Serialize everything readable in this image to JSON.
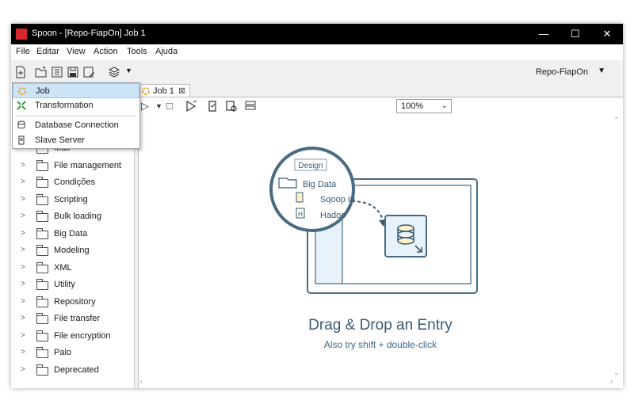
{
  "window": {
    "title": "Spoon - [Repo-FiapOn] Job 1",
    "minimize": "—",
    "maximize": "☐",
    "close": "✕"
  },
  "menubar": [
    "File",
    "Editar",
    "View",
    "Action",
    "Tools",
    "Ajuda"
  ],
  "toolbar": {
    "icons": [
      "new-file-icon",
      "open-folder-icon",
      "explore-icon",
      "save-icon",
      "save-as-icon",
      "layers-icon"
    ],
    "repository": "Repo-FiapOn"
  },
  "new_dropdown": {
    "items": [
      {
        "label": "Job",
        "icon": "job-icon",
        "selected": true
      },
      {
        "label": "Transformation",
        "icon": "transformation-icon",
        "selected": false
      },
      {
        "label": "Database Connection",
        "icon": "database-icon",
        "selected": false
      },
      {
        "label": "Slave Server",
        "icon": "server-icon",
        "selected": false
      }
    ]
  },
  "tree": {
    "items": [
      "Mail",
      "File management",
      "Condições",
      "Scripting",
      "Bulk loading",
      "Big Data",
      "Modeling",
      "XML",
      "Utility",
      "Repository",
      "File transfer",
      "File encryption",
      "Palo",
      "Deprecated"
    ]
  },
  "tabs": [
    {
      "label": "Job 1",
      "close": "⊠"
    }
  ],
  "canvas_toolbar": {
    "zoom": "100%"
  },
  "canvas": {
    "illustration": {
      "tab": "Design",
      "folder": "Big Data",
      "entry1": "Sqoop In",
      "entry2": "Hadoo",
      "entry2_badge": "H"
    },
    "heading": "Drag & Drop an Entry",
    "subheading": "Also try shift + double-click"
  }
}
